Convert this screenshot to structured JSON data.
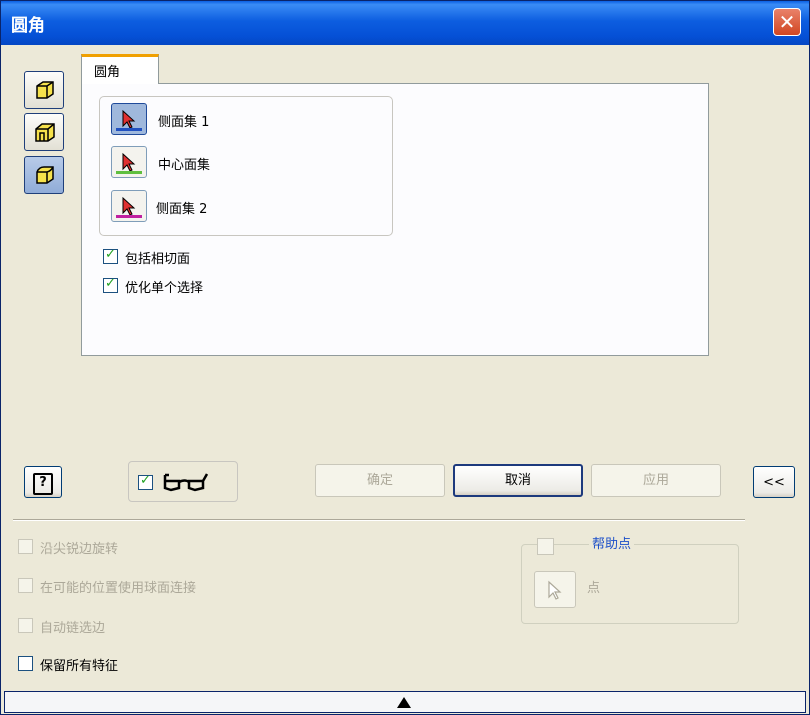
{
  "window": {
    "title": "圆角",
    "close_label": "✕"
  },
  "tab": {
    "label": "圆角"
  },
  "selections": [
    {
      "label": "侧面集 1",
      "accent": "#2050c0"
    },
    {
      "label": "中心面集",
      "accent": "#5fbf3f"
    },
    {
      "label": "侧面集 2",
      "accent": "#c020a0"
    }
  ],
  "options": {
    "include_tangent": {
      "label": "包括相切面",
      "checked": true
    },
    "optimize_single": {
      "label": "优化单个选择",
      "checked": true
    }
  },
  "buttons": {
    "help": "?",
    "ok": "确定",
    "cancel": "取消",
    "apply": "应用",
    "collapse": "<<"
  },
  "preview": {
    "checked": true
  },
  "advanced": {
    "rotate_along_sharp": {
      "label": "沿尖锐边旋转",
      "enabled": false
    },
    "use_sphere_blend": {
      "label": "在可能的位置使用球面连接",
      "enabled": false
    },
    "auto_chain": {
      "label": "自动链选边",
      "enabled": false
    },
    "preserve_features": {
      "label": "保留所有特征",
      "enabled": true,
      "checked": false
    },
    "help_point": {
      "label": "帮助点",
      "point_label": "点"
    }
  },
  "colors": {
    "title_bar": "#0a5fe3",
    "dialog_bg": "#ece9d8",
    "link_blue": "#1c4fc9"
  }
}
